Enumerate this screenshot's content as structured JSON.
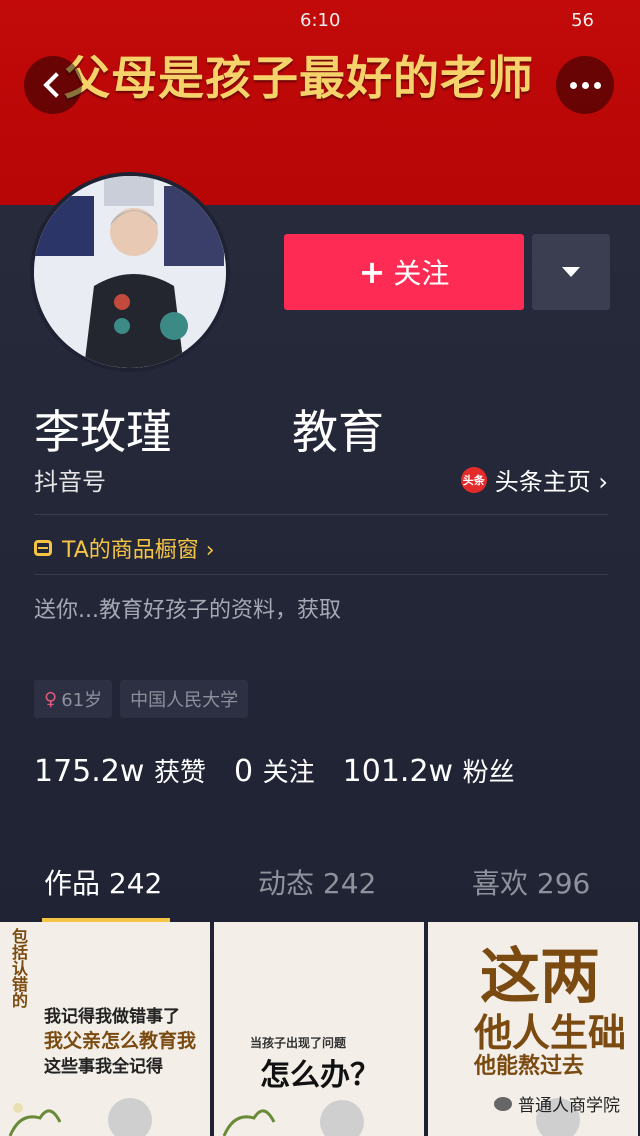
{
  "status_bar": {
    "time": "6:10",
    "battery": "56"
  },
  "banner": {
    "title": "父母是孩子最好的老师"
  },
  "profile": {
    "name_start": "李玫瑾",
    "name_end": "教育",
    "douyin_id_label": "抖音号",
    "toutiao_badge": "头条",
    "toutiao_link": "头条主页 ›",
    "follow_label": "关注",
    "shop_label": "TA的商品橱窗 ›",
    "bio": "送你...教育好孩子的资料，获取",
    "tags": [
      {
        "text": "61岁"
      },
      {
        "text": "中国人民大学"
      }
    ]
  },
  "stats": [
    {
      "value": "175.2w",
      "label": "获赞"
    },
    {
      "value": "0",
      "label": "关注"
    },
    {
      "value": "101.2w",
      "label": "粉丝"
    }
  ],
  "tabs": [
    {
      "label": "作品 242"
    },
    {
      "label": "动态 242"
    },
    {
      "label": "喜欢 296"
    }
  ],
  "thumbs": {
    "t1_vertical": "包括认错的",
    "t1_line1": "我记得我做错事了",
    "t1_line2": "我父亲怎么教育我",
    "t1_line3": "这些事我全记得",
    "t2_small": "当孩子出现了问题",
    "t2_big": "怎么办？",
    "t3_big": "这两",
    "t3_mid": "他人生础",
    "t3_small": "他能熬过去"
  },
  "watermark": "普通人商学院",
  "colors": {
    "follow": "#fe2c55",
    "banner": "#c20a0a",
    "accent": "#f6c445"
  }
}
